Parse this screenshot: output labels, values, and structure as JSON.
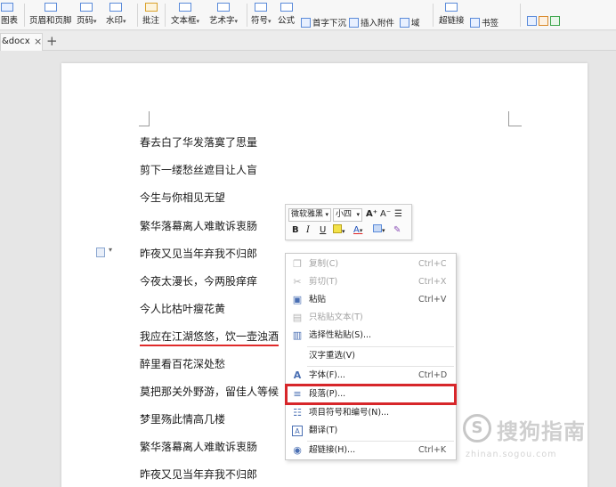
{
  "ribbon": {
    "items": [
      {
        "label": "图表",
        "arrow": ""
      },
      {
        "label": "页眉和页脚",
        "arrow": ""
      },
      {
        "label": "页码",
        "arrow": "▾"
      },
      {
        "label": "水印",
        "arrow": "▾"
      },
      {
        "label": "批注",
        "arrow": ""
      },
      {
        "label": "文本框",
        "arrow": "▾"
      },
      {
        "label": "艺术字",
        "arrow": "▾"
      },
      {
        "label": "符号",
        "arrow": "▾"
      },
      {
        "label": "公式",
        "arrow": ""
      },
      {
        "label": "首字下沉",
        "arrow": ""
      },
      {
        "label": "插入附件",
        "arrow": ""
      },
      {
        "label": "域",
        "arrow": ""
      },
      {
        "label": "超链接",
        "arrow": ""
      },
      {
        "label": "书签",
        "arrow": ""
      }
    ]
  },
  "tab": {
    "name": "&docx",
    "close": "×",
    "new": "+"
  },
  "document": {
    "lines": [
      "春去白了华发落寞了思量",
      "剪下一缕愁丝遮目让人盲",
      "今生与你相见无望",
      "繁华落幕离人难敢诉衷肠",
      "昨夜又见当年弃我不归郎",
      "今夜太漫长，今两股痒痒",
      "今人比枯叶瘦花黄",
      "我应在江湖悠悠，饮一壶浊酒",
      "醉里看百花深处愁",
      "莫把那关外野游，留佳人等候",
      "梦里殇此情高几楼",
      "繁华落幕离人难敢诉衷肠",
      "昨夜又见当年弃我不归郎"
    ]
  },
  "minibar": {
    "font": "微软雅黑",
    "size": "小四",
    "grow": "A⁺",
    "shrink": "A⁻",
    "bold": "B",
    "italic": "I",
    "underline": "U"
  },
  "context_menu": {
    "items": [
      {
        "label": "复制(C)",
        "shortcut": "Ctrl+C",
        "icon": "copy-icon",
        "disabled": true
      },
      {
        "label": "剪切(T)",
        "shortcut": "Ctrl+X",
        "icon": "scissors-icon",
        "disabled": true
      },
      {
        "label": "粘贴",
        "shortcut": "Ctrl+V",
        "icon": "paste-icon",
        "disabled": false
      },
      {
        "label": "只粘贴文本(T)",
        "shortcut": "",
        "icon": "paste-text-icon",
        "disabled": true
      },
      {
        "label": "选择性粘贴(S)...",
        "shortcut": "",
        "icon": "paste-special-icon",
        "disabled": false
      },
      {
        "label": "汉字重选(V)",
        "shortcut": "",
        "icon": "",
        "disabled": false
      },
      {
        "label": "字体(F)...",
        "shortcut": "Ctrl+D",
        "icon": "font-icon",
        "disabled": false
      },
      {
        "label": "段落(P)...",
        "shortcut": "",
        "icon": "paragraph-icon",
        "disabled": false,
        "highlighted": true
      },
      {
        "label": "项目符号和编号(N)...",
        "shortcut": "",
        "icon": "list-icon",
        "disabled": false
      },
      {
        "label": "翻译(T)",
        "shortcut": "",
        "icon": "translate-icon",
        "disabled": false
      },
      {
        "label": "超链接(H)...",
        "shortcut": "Ctrl+K",
        "icon": "hyperlink-icon",
        "disabled": false
      }
    ]
  },
  "watermark": {
    "mark": "S",
    "text": "搜狗指南",
    "url": "zhinan.sogou.com"
  },
  "colors": {
    "highlight": "#d7262a",
    "selection_underline": "#e02a2a",
    "accent": "#5b8bd9"
  }
}
